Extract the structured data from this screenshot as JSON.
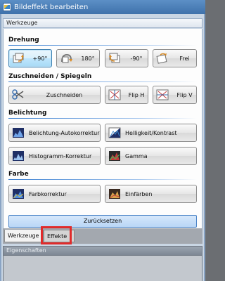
{
  "window": {
    "title": "Bildeffekt bearbeiten"
  },
  "panel": {
    "title": "Werkzeuge"
  },
  "sections": {
    "rotation": {
      "title": "Drehung",
      "buttons": [
        "+90°",
        "180°",
        "-90°",
        "Frei"
      ]
    },
    "crop": {
      "title": "Zuschneiden / Spiegeln",
      "buttons": [
        "Zuschneiden",
        "Flip H",
        "Flip V"
      ]
    },
    "exposure": {
      "title": "Belichtung",
      "buttons": [
        "Belichtung-Autokorrektur",
        "Helligkeit/Kontrast",
        "Histogramm-Korrektur",
        "Gamma"
      ]
    },
    "color": {
      "title": "Farbe",
      "buttons": [
        "Farbkorrektur",
        "Einfärben"
      ]
    }
  },
  "reset_label": "Zurücksetzen",
  "tabs": [
    "Werkzeuge",
    "Effekte"
  ],
  "properties": {
    "title": "Eigenschaften"
  },
  "colors": {
    "accent": "#3b7fd0",
    "highlight": "#e02b2b"
  }
}
